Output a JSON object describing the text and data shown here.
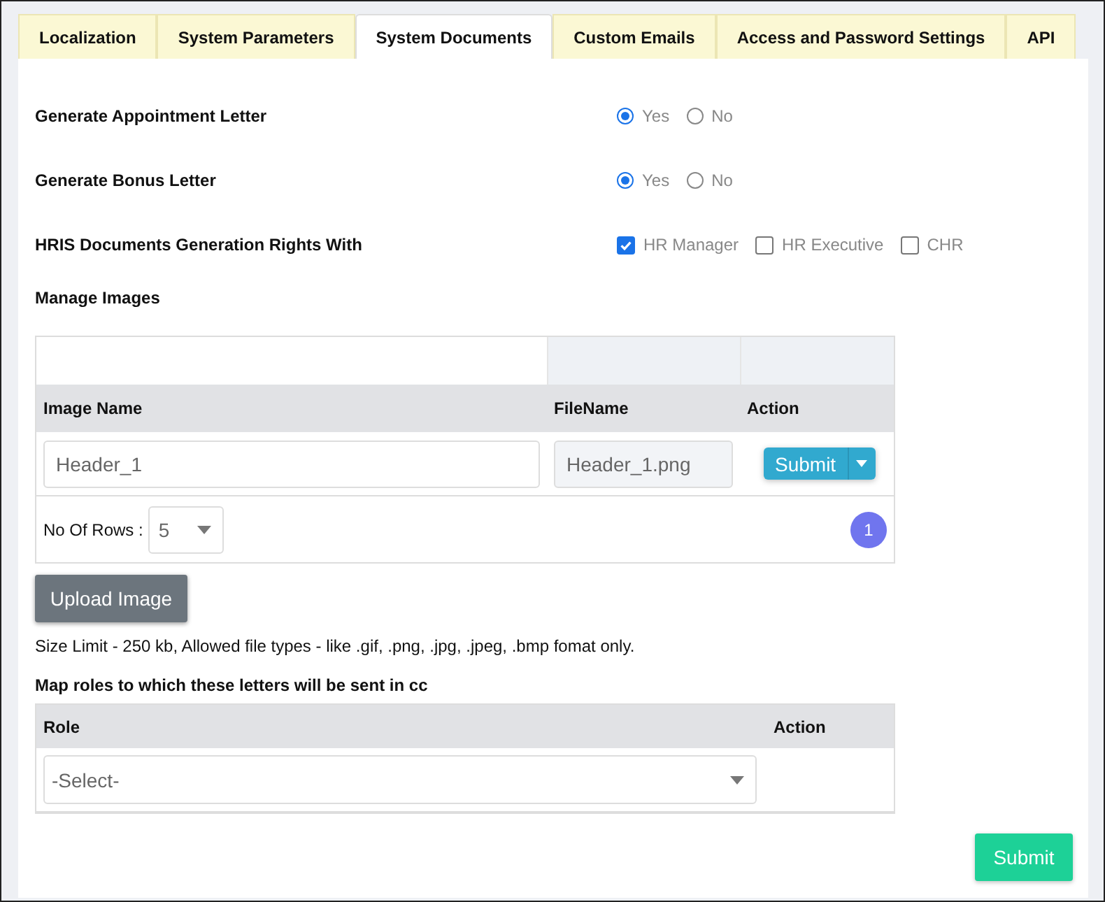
{
  "tabs": [
    {
      "label": "Localization",
      "selected": false
    },
    {
      "label": "System Parameters",
      "selected": false
    },
    {
      "label": "System Documents",
      "selected": true
    },
    {
      "label": "Custom Emails",
      "selected": false
    },
    {
      "label": "Access and Password Settings",
      "selected": false
    },
    {
      "label": "API",
      "selected": false
    }
  ],
  "settings": [
    {
      "label": "Generate Appointment Letter",
      "kind": "radio",
      "options": [
        {
          "label": "Yes",
          "selected": true
        },
        {
          "label": "No",
          "selected": false
        }
      ]
    },
    {
      "label": "Generate Bonus Letter",
      "kind": "radio",
      "options": [
        {
          "label": "Yes",
          "selected": true
        },
        {
          "label": "No",
          "selected": false
        }
      ]
    },
    {
      "label": "HRIS Documents Generation Rights With",
      "kind": "checkbox",
      "options": [
        {
          "label": "HR Manager",
          "checked": true
        },
        {
          "label": "HR Executive",
          "checked": false
        },
        {
          "label": "CHR",
          "checked": false
        }
      ]
    }
  ],
  "manage_images": {
    "heading": "Manage Images",
    "columns": [
      "Image Name",
      "FileName",
      "Action"
    ],
    "rows": [
      {
        "image_name": "Header_1",
        "file_name": "Header_1.png",
        "action": "Submit"
      }
    ],
    "rows_per_page": {
      "label": "No Of Rows :",
      "value": "5"
    },
    "pages": [
      {
        "label": "1",
        "selected": true
      }
    ]
  },
  "upload_button": "Upload Image",
  "size_note": "Size Limit - 250 kb, Allowed file types - like .gif, .png, .jpg, .jpeg, .bmp fomat only.",
  "roles": {
    "heading": "Map roles to which these letters will be sent in cc",
    "columns": [
      "Role",
      "Action"
    ],
    "select_placeholder": "-Select-"
  },
  "submit_button": "Submit"
}
